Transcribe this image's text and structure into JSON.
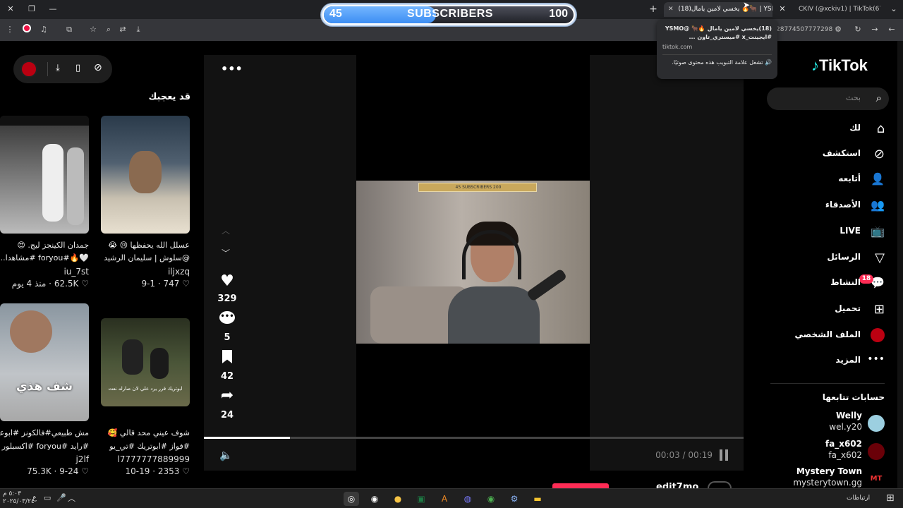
{
  "browser": {
    "tabs": [
      {
        "label": "(18)يخسي لامين يامال 🔥🐂 | YSMO"
      },
      {
        "label": "CKIV (@xckiv1) | TikTok(67)"
      }
    ],
    "address_fragment": "28774507777298",
    "tab_popup": {
      "title": "(18)يخسي لامين يامال 🔥🐂 @YSMO #ايجينت_x #ميستري_تاون ...",
      "domain": "tiktok.com",
      "note": "تشغل علامة التبويب هذه محتوى صوتيًا."
    }
  },
  "overlay": {
    "current": "45",
    "label": "SUBSCRIBERS",
    "goal": "100",
    "progress_fraction": 0.45
  },
  "suggestions": {
    "title": "قد يعجبك",
    "cards": [
      {
        "text1": "عسلل الله يحفظها 😢 😭",
        "text2": "@سلوش | سليمان الرشيد",
        "user": "iljxzq",
        "likes": "747",
        "date": "9-1"
      },
      {
        "text1": "جمدان الكينجز ليج. 😍",
        "text2": "🤍🔥#foryou #مشاهدا...",
        "user": "iu_7st",
        "likes": "62.5K",
        "date": "منذ 4 يوم"
      },
      {
        "text1": "شوف عيني محد قالي 🥰",
        "text2": "#فواز #ابوتريك #تي_يو",
        "user": "l7777777889999",
        "likes": "2353",
        "date": "10-19",
        "overlay_text": "ابوتريك قرر يرد علي لان صارله نعت"
      },
      {
        "text1": "مش طبيعي#فالكونز #ابوعبير",
        "text2": "#رايد #foryou #اكسبلور",
        "user": "j2lf",
        "likes": "75.3K",
        "date": "9-24",
        "overlay_text": "شف هذي"
      }
    ]
  },
  "player": {
    "actions": {
      "likes": "329",
      "comments": "5",
      "saves": "42",
      "shares": "24"
    },
    "time": "00:03 / 00:19",
    "progress_fraction": 0.16,
    "author": "edit7mo",
    "stream_overlay": "45 SUBSCRIBERS 200"
  },
  "sidebar": {
    "logo": "TikTok",
    "search_placeholder": "بحث",
    "nav": [
      {
        "label": "لك"
      },
      {
        "label": "استكشف"
      },
      {
        "label": "أتابعه"
      },
      {
        "label": "الأصدقاء"
      },
      {
        "label": "LIVE"
      },
      {
        "label": "الرسائل"
      },
      {
        "label": "النشاط",
        "badge": "18"
      },
      {
        "label": "تحميل"
      },
      {
        "label": "الملف الشخصي"
      },
      {
        "label": "المزيد"
      }
    ],
    "following_title": "حسابات تتابعها",
    "following": [
      {
        "name": "Welly",
        "handle": "wel.y20"
      },
      {
        "name": "fa_x602",
        "handle": "fa_x602"
      },
      {
        "name": "Mystery Town",
        "handle": "mysterytown.gg"
      }
    ]
  },
  "taskbar": {
    "clock_time": "٥:٠٣ م",
    "clock_date": "٢٠٢٥/٠٣/٢٤",
    "lang": "ع",
    "links_label": "ارتباطات"
  }
}
